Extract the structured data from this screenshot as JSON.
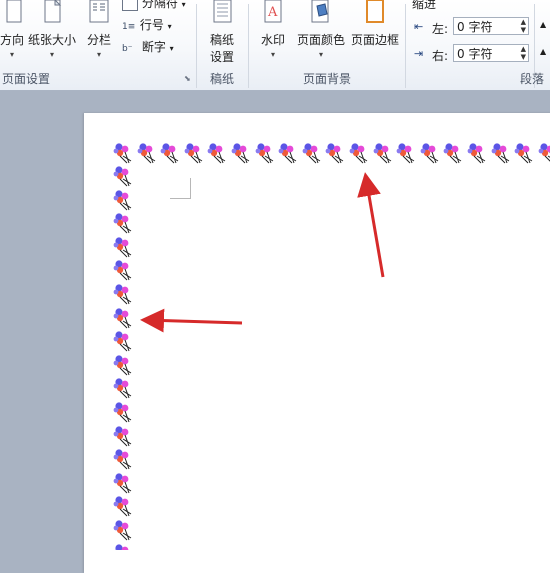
{
  "ribbon": {
    "page_setup": {
      "group_label": "页面设置",
      "orientation_label": "方向",
      "size_label": "纸张大小",
      "columns_label": "分栏",
      "breaks_label": "分隔符",
      "line_numbers_label": "行号",
      "hyphenation_label": "断字"
    },
    "draft": {
      "group_label": "稿纸",
      "button_label_line1": "稿纸",
      "button_label_line2": "设置"
    },
    "page_background": {
      "group_label": "页面背景",
      "watermark_label": "水印",
      "page_color_label": "页面颜色",
      "page_borders_label": "页面边框"
    },
    "paragraph": {
      "group_label": "段落",
      "indent_label": "缩进",
      "left_label": "左:",
      "left_value": "0 字符",
      "right_label": "右:",
      "right_value": "0 字符"
    }
  },
  "colors": {
    "ribbon_bg": "#f3f6fa",
    "workspace_bg": "#a9b3c2",
    "arrow_red": "#d62a2a"
  },
  "icons": [
    "orientation-icon",
    "paper-size-icon",
    "columns-icon",
    "breaks-icon",
    "line-numbers-icon",
    "hyphenation-icon",
    "draft-paper-icon",
    "watermark-icon",
    "page-color-icon",
    "page-borders-icon",
    "indent-left-icon",
    "indent-right-icon",
    "balloon-border-icon"
  ]
}
